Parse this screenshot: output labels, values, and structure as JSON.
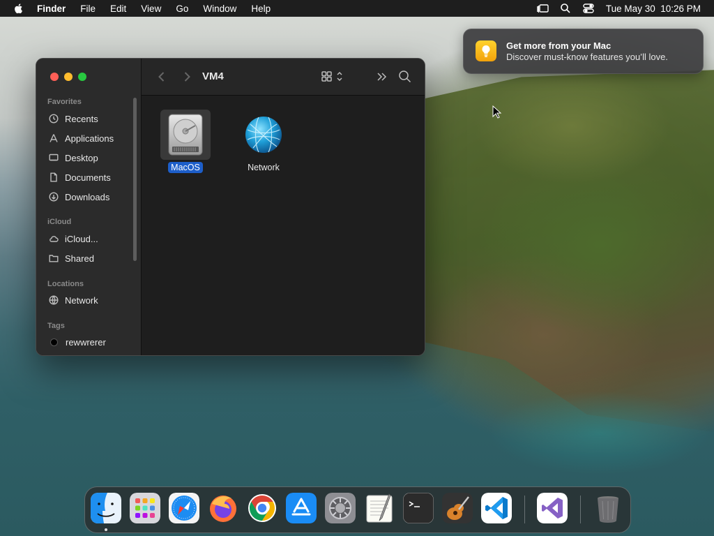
{
  "menubar": {
    "app": "Finder",
    "items": [
      "File",
      "Edit",
      "View",
      "Go",
      "Window",
      "Help"
    ],
    "datetime": "Tue May 30  10:26 PM"
  },
  "notification": {
    "title": "Get more from your Mac",
    "body": "Discover must-know features you’ll love.",
    "icon": "lightbulb-icon"
  },
  "finder": {
    "title": "VM4",
    "sidebar": {
      "favorites_heading": "Favorites",
      "favorites": [
        "Recents",
        "Applications",
        "Desktop",
        "Documents",
        "Downloads"
      ],
      "icloud_heading": "iCloud",
      "icloud": [
        "iCloud...",
        "Shared"
      ],
      "locations_heading": "Locations",
      "locations": [
        "Network"
      ],
      "tags_heading": "Tags",
      "tags": [
        "rewwrerer"
      ]
    },
    "items": [
      {
        "label": "MacOS",
        "icon": "hard-drive-icon",
        "selected": true
      },
      {
        "label": "Network",
        "icon": "network-globe-icon",
        "selected": false
      }
    ]
  },
  "dock": {
    "apps": [
      "Finder",
      "Launchpad",
      "Safari",
      "Firefox",
      "Chrome",
      "App Store",
      "System Settings",
      "TextEdit",
      "Terminal",
      "GarageBand",
      "Visual Studio Code",
      "Visual Studio",
      "Trash"
    ]
  },
  "colors": {
    "selection": "#1d5ec9",
    "close": "#ff5f57",
    "minimize": "#febc2e",
    "zoom": "#28c840"
  }
}
